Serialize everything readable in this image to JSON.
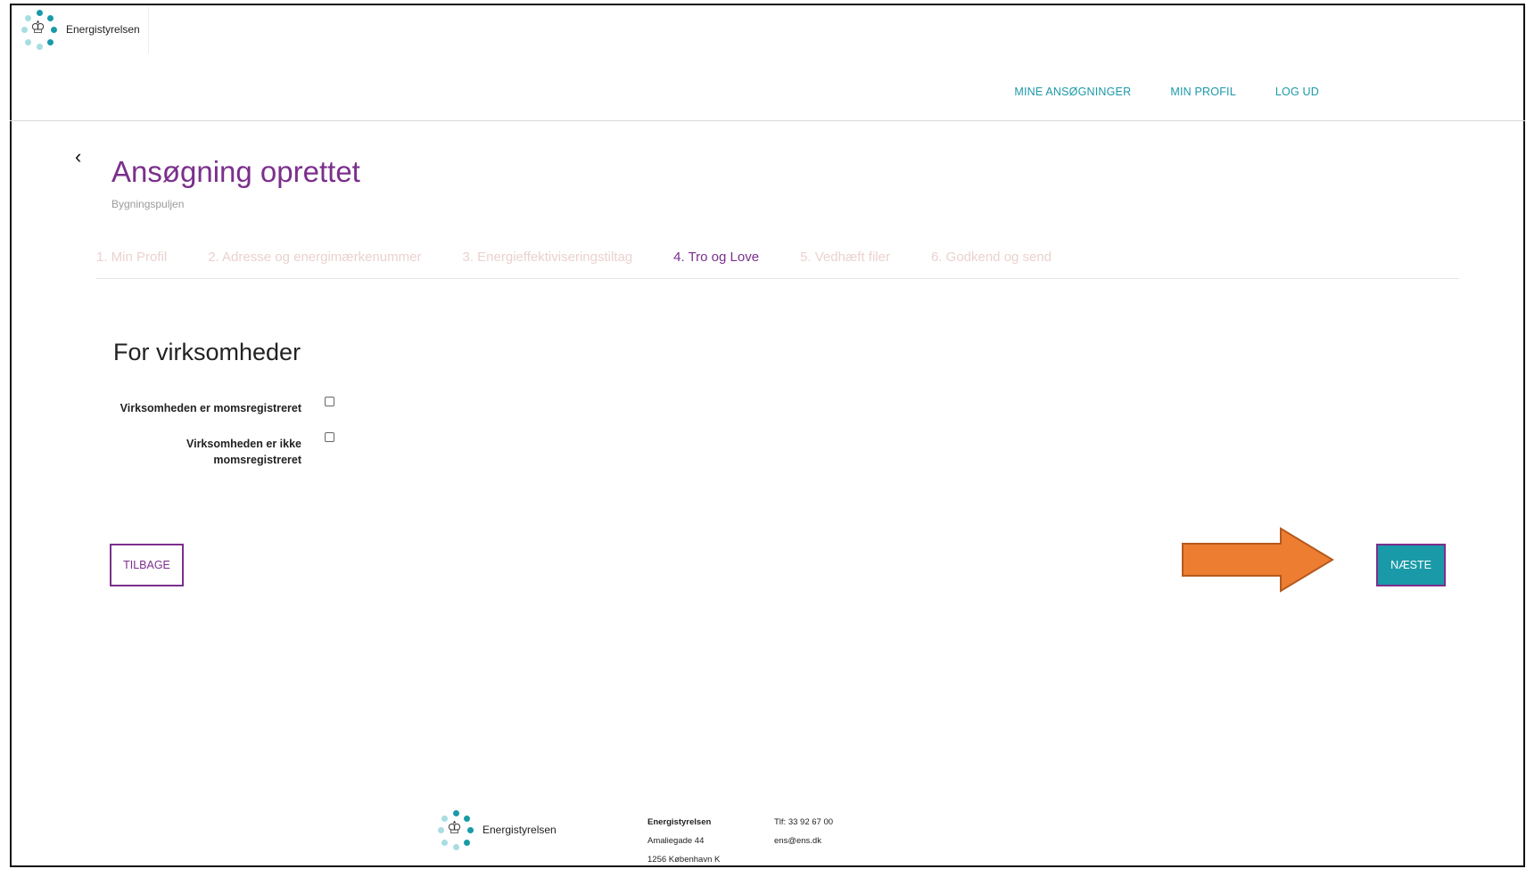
{
  "brand": {
    "name": "Energistyrelsen",
    "logo_icon": "crown-dots-logo"
  },
  "nav": {
    "items": [
      "MINE ANSØGNINGER",
      "MIN PROFIL",
      "LOG UD"
    ]
  },
  "page": {
    "title": "Ansøgning oprettet",
    "subtitle": "Bygningspuljen"
  },
  "steps": [
    {
      "label": "1. Min Profil",
      "active": false
    },
    {
      "label": "2. Adresse og energimærkenummer",
      "active": false
    },
    {
      "label": "3. Energieffektiviseringstiltag",
      "active": false
    },
    {
      "label": "4. Tro og Love",
      "active": true
    },
    {
      "label": "5. Vedhæft filer",
      "active": false
    },
    {
      "label": "6. Godkend og send",
      "active": false
    }
  ],
  "form": {
    "section_title": "For virksomheder",
    "options": [
      {
        "label": "Virksomheden er momsregistreret",
        "checked": false
      },
      {
        "label_line1": "Virksomheden er ikke",
        "label_line2": "momsregistreret",
        "checked": false
      }
    ]
  },
  "buttons": {
    "back": "TILBAGE",
    "next": "NÆSTE"
  },
  "annotation": {
    "arrow_color": "#ed7d31"
  },
  "footer": {
    "org": "Energistyrelsen",
    "street": "Amaliegade 44",
    "city": "1256 København K",
    "phone": "Tlf: 33 92 67 00",
    "email": "ens@ens.dk"
  },
  "colors": {
    "accent": "#1a9aa8",
    "brand_purple": "#7b2f8c",
    "inactive_step": "#ead2cf"
  }
}
